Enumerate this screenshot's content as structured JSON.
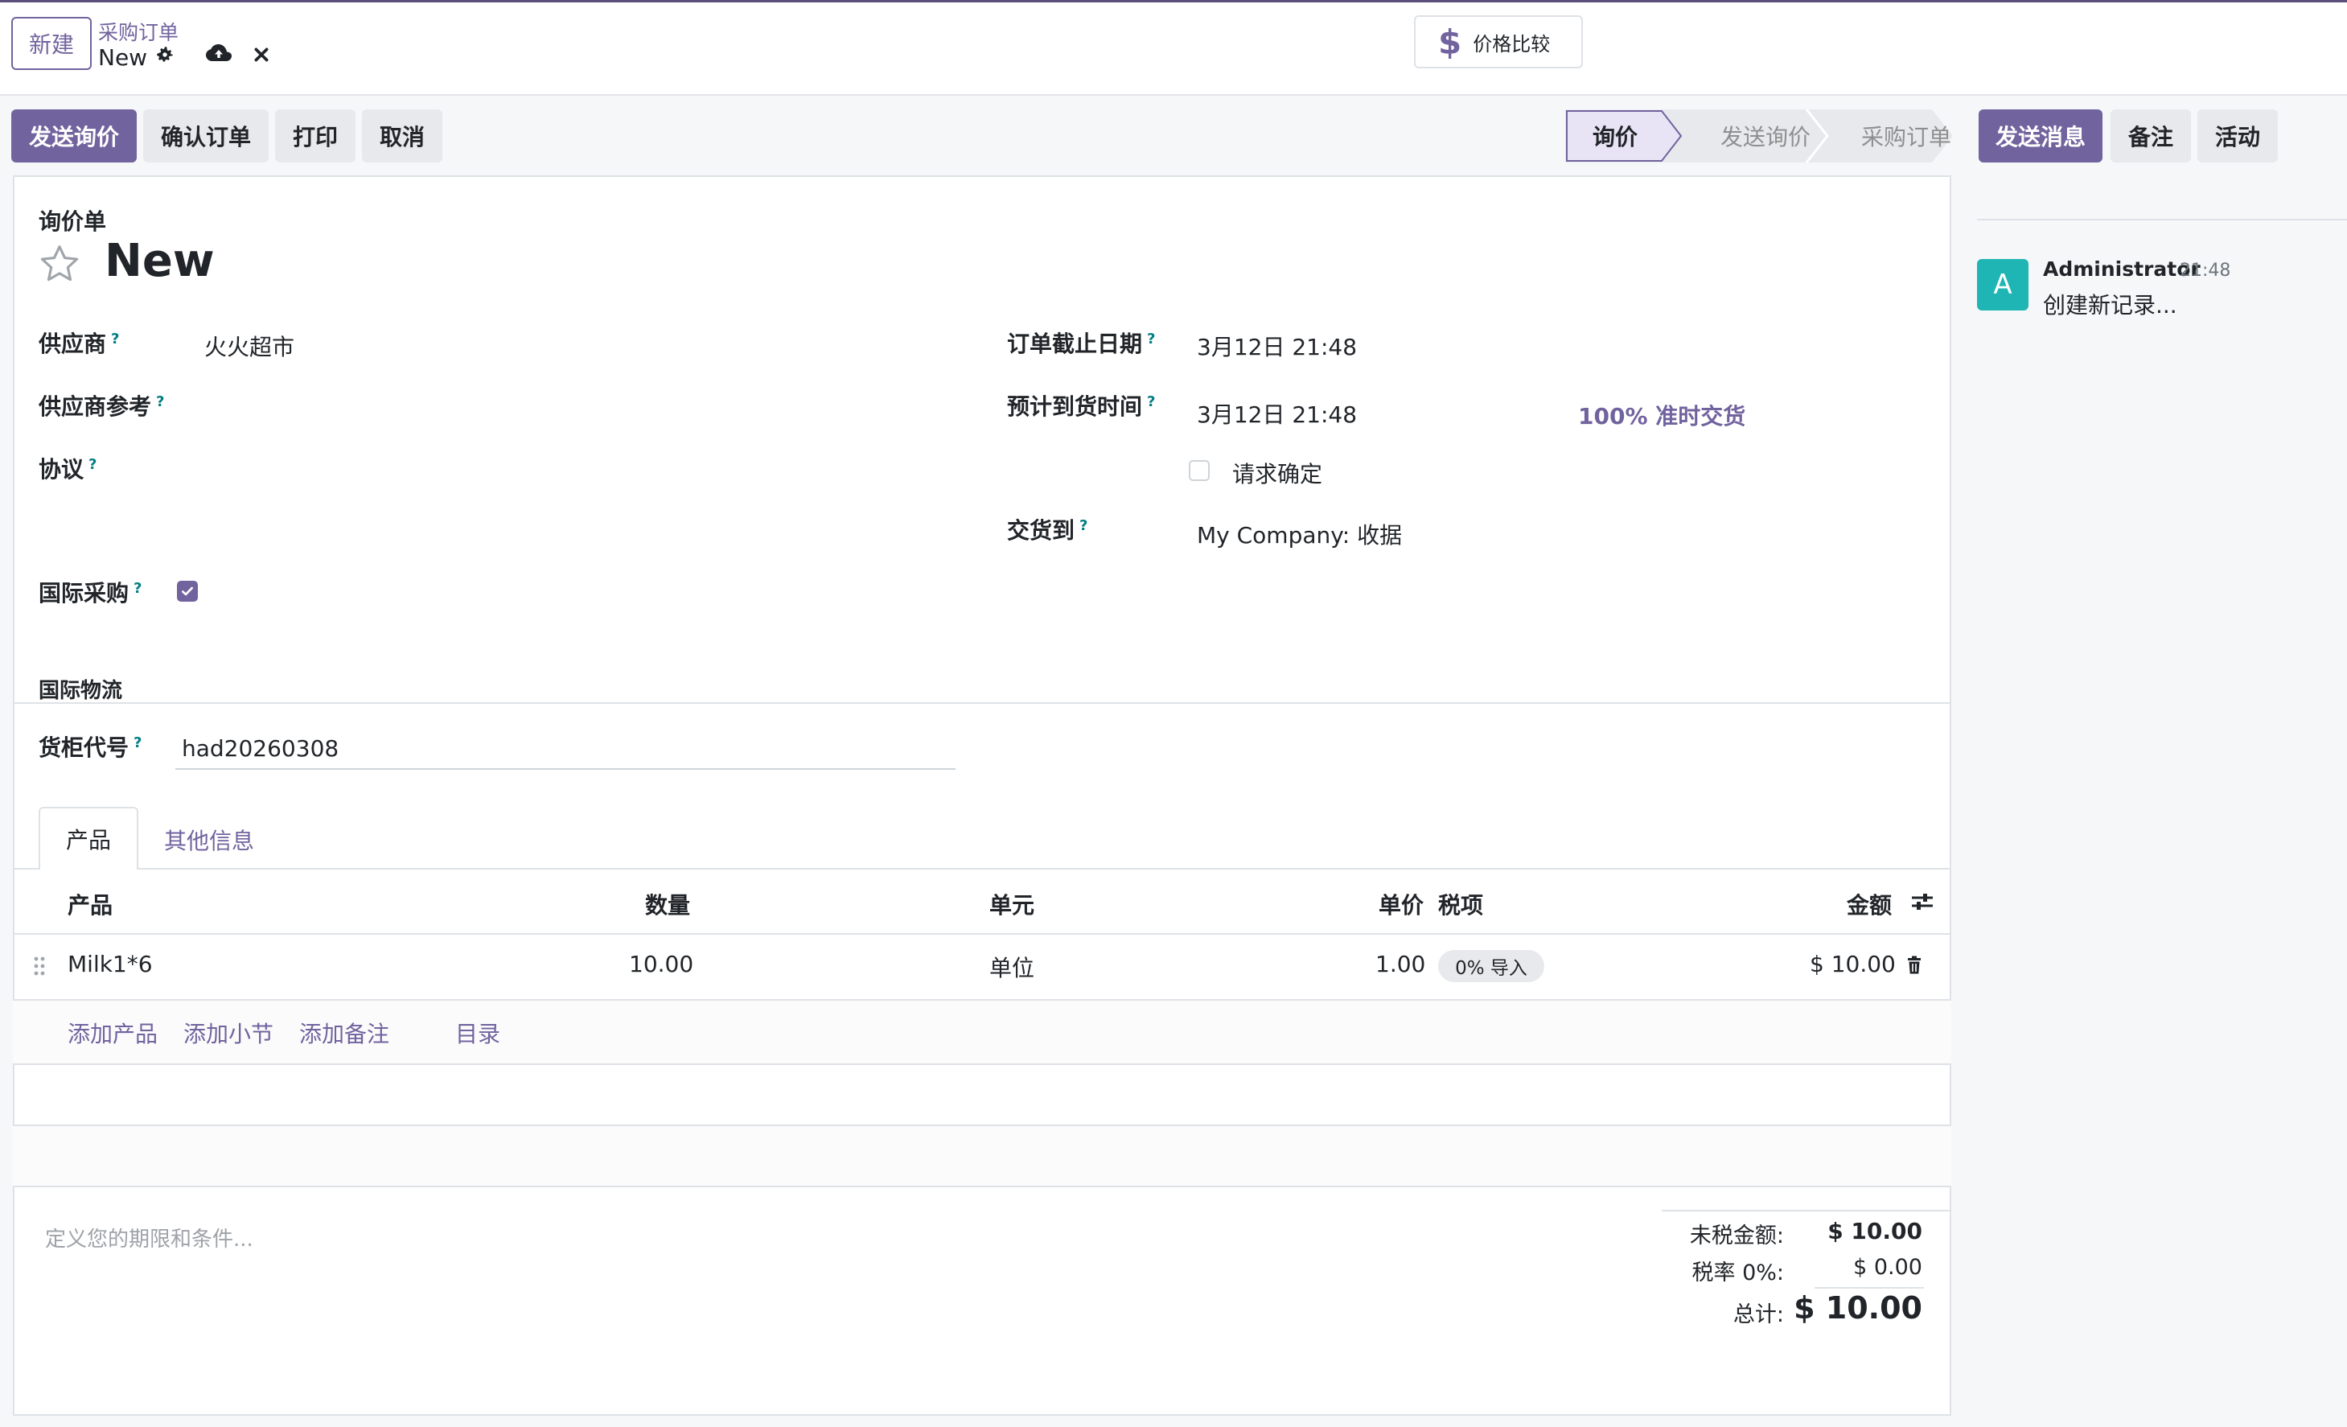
{
  "header": {
    "new_button": "新建",
    "breadcrumb_parent": "采购订单",
    "breadcrumb_current": "New",
    "price_compare": "价格比较"
  },
  "actions": {
    "send_rfq": "发送询价",
    "confirm_order": "确认订单",
    "print": "打印",
    "cancel": "取消"
  },
  "status": {
    "stages": [
      "询价",
      "发送询价",
      "采购订单"
    ],
    "active_stage": "询价"
  },
  "chatter_buttons": {
    "send_message": "发送消息",
    "log_note": "备注",
    "activity": "活动"
  },
  "form": {
    "doc_type": "询价单",
    "name": "New",
    "supplier_label": "供应商",
    "supplier_value": "火火超市",
    "supplier_ref_label": "供应商参考",
    "agreement_label": "协议",
    "international_label": "国际采购",
    "international_checked": true,
    "order_deadline_label": "订单截止日期",
    "order_deadline_value": "3月12日 21:48",
    "expected_arrival_label": "预计到货时间",
    "expected_arrival_value": "3月12日 21:48",
    "on_time_rate": "100% 准时交货",
    "ask_confirmation_label": "请求确定",
    "deliver_to_label": "交货到",
    "deliver_to_value": "My Company: 收据",
    "logistics_section": "国际物流",
    "container_label": "货柜代号",
    "container_value": "had20260308"
  },
  "tabs": {
    "products": "产品",
    "other_info": "其他信息"
  },
  "table": {
    "headers": {
      "product": "产品",
      "quantity": "数量",
      "unit": "单元",
      "unit_price": "单价",
      "taxes": "税项",
      "amount": "金额"
    },
    "rows": [
      {
        "product": "Milk1*6",
        "quantity": "10.00",
        "unit": "单位",
        "unit_price": "1.00",
        "tax": "0% 导入",
        "amount": "$ 10.00"
      }
    ],
    "add_product": "添加产品",
    "add_section": "添加小节",
    "add_note": "添加备注",
    "catalog": "目录"
  },
  "terms_placeholder": "定义您的期限和条件...",
  "totals": {
    "untaxed_label": "未税金额:",
    "untaxed_value": "$ 10.00",
    "tax_label": "税率 0%:",
    "tax_value": "$ 0.00",
    "total_label": "总计:",
    "total_value": "$ 10.00"
  },
  "chatter": {
    "avatar_letter": "A",
    "author": "Administrator",
    "time": "21:48",
    "message": "创建新记录..."
  },
  "colors": {
    "primary": "#71639e",
    "avatar": "#1fb5b5",
    "help": "#017e84"
  }
}
